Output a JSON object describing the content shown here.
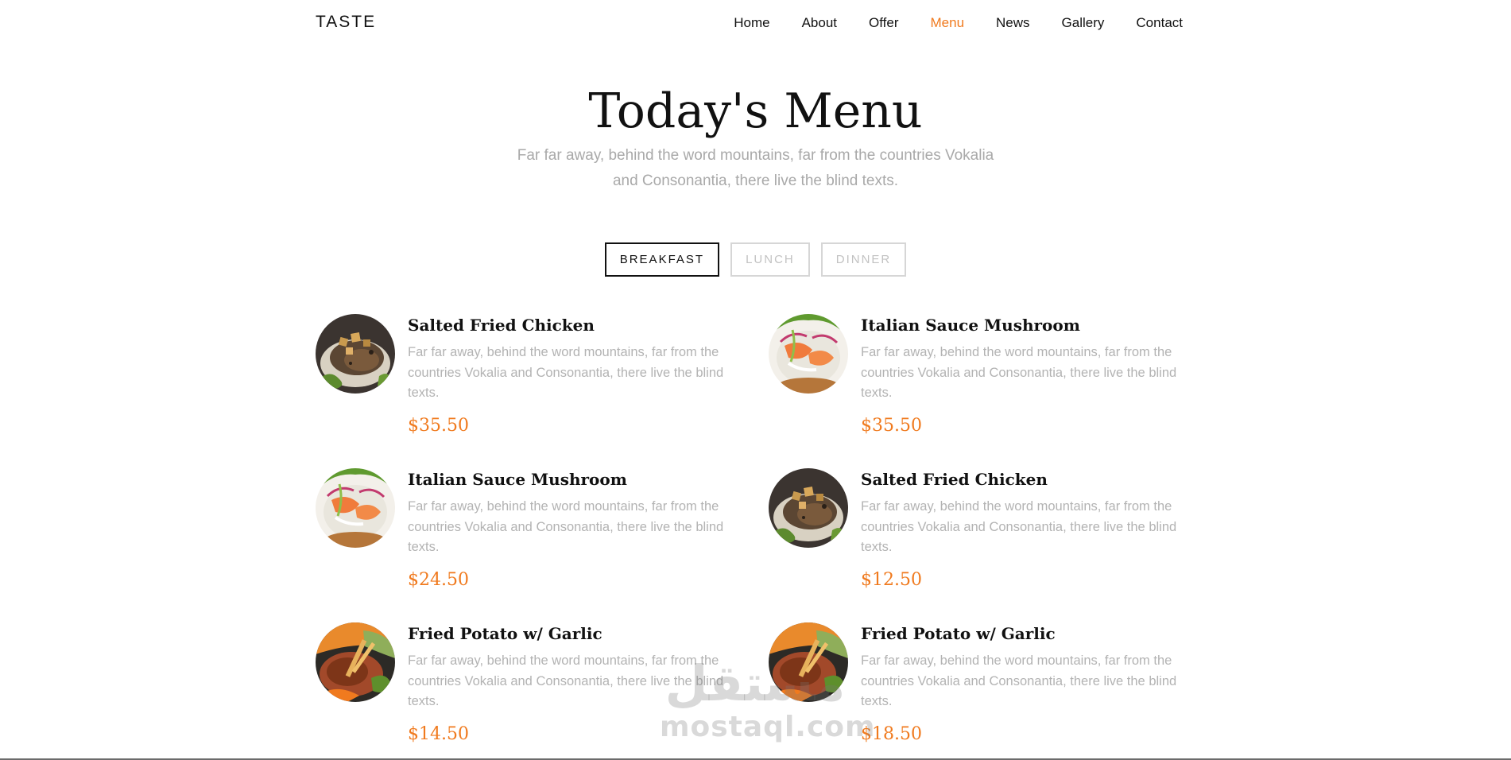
{
  "brand": "TASTE",
  "nav": [
    {
      "label": "Home",
      "active": false
    },
    {
      "label": "About",
      "active": false
    },
    {
      "label": "Offer",
      "active": false
    },
    {
      "label": "Menu",
      "active": true
    },
    {
      "label": "News",
      "active": false
    },
    {
      "label": "Gallery",
      "active": false
    },
    {
      "label": "Contact",
      "active": false
    }
  ],
  "heading": {
    "title": "Today's Menu",
    "subtitle": "Far far away, behind the word mountains, far from the countries Vokalia and Consonantia, there live the blind texts."
  },
  "tabs": [
    {
      "label": "BREAKFAST",
      "active": true
    },
    {
      "label": "LUNCH",
      "active": false
    },
    {
      "label": "DINNER",
      "active": false
    }
  ],
  "menu_items": [
    {
      "name": "Salted Fried Chicken",
      "description": "Far far away, behind the word mountains, far from the countries Vokalia and Consonantia, there live the blind texts.",
      "price": "$35.50",
      "image": "chicken-dish"
    },
    {
      "name": "Italian Sauce Mushroom",
      "description": "Far far away, behind the word mountains, far from the countries Vokalia and Consonantia, there live the blind texts.",
      "price": "$35.50",
      "image": "salad-dish"
    },
    {
      "name": "Italian Sauce Mushroom",
      "description": "Far far away, behind the word mountains, far from the countries Vokalia and Consonantia, there live the blind texts.",
      "price": "$24.50",
      "image": "salad-dish"
    },
    {
      "name": "Salted Fried Chicken",
      "description": "Far far away, behind the word mountains, far from the countries Vokalia and Consonantia, there live the blind texts.",
      "price": "$12.50",
      "image": "chicken-dish"
    },
    {
      "name": "Fried Potato w/ Garlic",
      "description": "Far far away, behind the word mountains, far from the countries Vokalia and Consonantia, there live the blind texts.",
      "price": "$14.50",
      "image": "potato-dish"
    },
    {
      "name": "Fried Potato w/ Garlic",
      "description": "Far far away, behind the word mountains, far from the countries Vokalia and Consonantia, there live the blind texts.",
      "price": "$18.50",
      "image": "potato-dish"
    }
  ],
  "watermark": {
    "arabic": "مستقل",
    "latin": "mostaql.com"
  },
  "colors": {
    "accent": "#f07a1e",
    "muted_text": "#b3b3b3",
    "heading_text": "#111111"
  }
}
